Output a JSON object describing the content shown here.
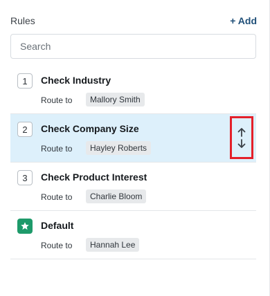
{
  "header": {
    "title": "Rules",
    "add_label": "+ Add"
  },
  "search": {
    "placeholder": "Search",
    "value": ""
  },
  "rules": [
    {
      "number": "1",
      "name": "Check Industry",
      "route_label": "Route to",
      "assignee": "Mallory Smith"
    },
    {
      "number": "2",
      "name": "Check Company Size",
      "route_label": "Route to",
      "assignee": "Hayley Roberts"
    },
    {
      "number": "3",
      "name": "Check Product Interest",
      "route_label": "Route to",
      "assignee": "Charlie Bloom"
    },
    {
      "number": "",
      "name": "Default",
      "route_label": "Route to",
      "assignee": "Hannah Lee",
      "icon": "star-icon"
    }
  ],
  "selected_index": 1,
  "colors": {
    "accent": "#1f4f78",
    "selected_row": "#ddf0fb",
    "default_badge": "#1e9a6a",
    "highlight_outline": "#e4202a"
  }
}
